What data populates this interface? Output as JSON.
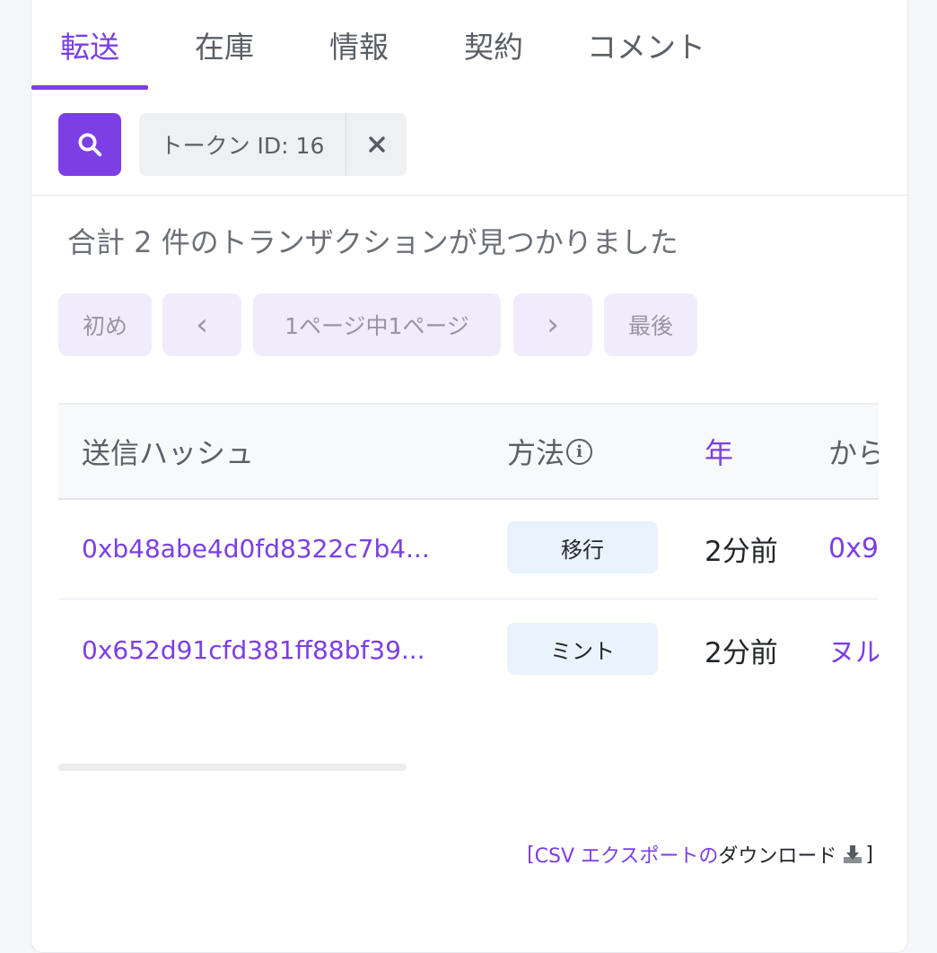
{
  "tabs": [
    {
      "label": "転送"
    },
    {
      "label": "在庫"
    },
    {
      "label": "情報"
    },
    {
      "label": "契約"
    },
    {
      "label": "コメント"
    }
  ],
  "filter": {
    "label": "トークン ID: 16"
  },
  "summary": "合計 2 件のトランザクションが見つかりました",
  "pagination": {
    "first": "初め",
    "prev": "‹",
    "page_info": "1ページ中1ページ",
    "next": "›",
    "last": "最後"
  },
  "table": {
    "headers": {
      "hash": "送信ハッシュ",
      "method": "方法",
      "age": "年",
      "from": "から"
    },
    "rows": [
      {
        "hash": "0xb48abe4d0fd8322c7b4...",
        "method": "移行",
        "age": "2分前",
        "from": "0x9"
      },
      {
        "hash": "0x652d91cfd381ff88bf39...",
        "method": "ミント",
        "age": "2分前",
        "from": "ヌル"
      }
    ]
  },
  "csv": {
    "open": "[ ",
    "accent": "CSV エクスポートの",
    "plain": "ダウンロード",
    "close": "]"
  },
  "colors": {
    "accent": "#7b3fe4",
    "method_badge": "#e9f3fd",
    "pagination_bg": "#f1ecfc"
  },
  "icons": {
    "search": "search-icon",
    "close": "close-icon",
    "info": "info-icon",
    "download": "download-icon"
  }
}
